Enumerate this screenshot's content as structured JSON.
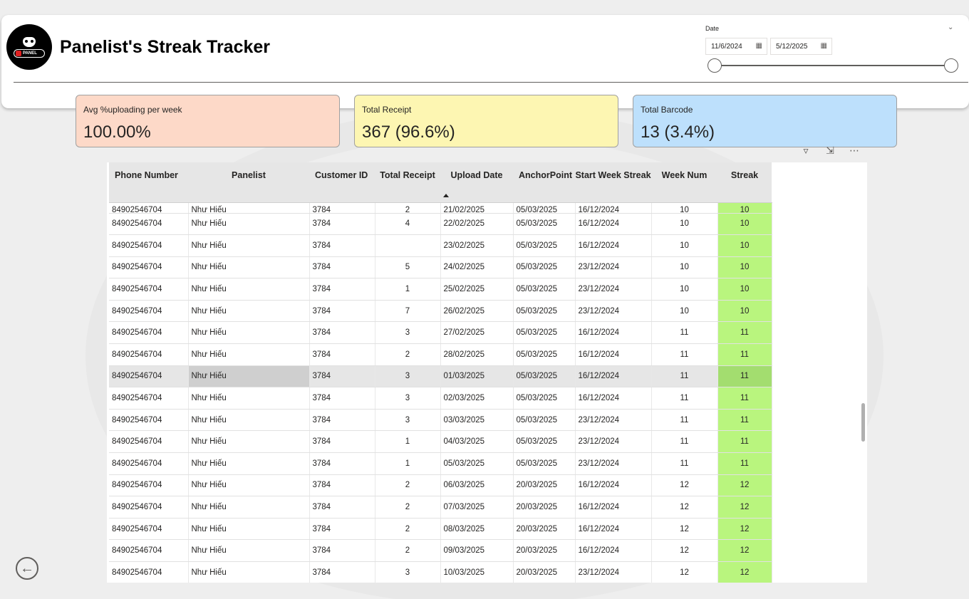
{
  "header": {
    "title": "Panelist's Streak Tracker",
    "logo_text": "PANEL"
  },
  "date_slicer": {
    "label": "Date",
    "start": "11/6/2024",
    "end": "5/12/2025"
  },
  "kpis": [
    {
      "label": "Avg %uploading per week",
      "value": "100.00%",
      "color": "#fdd9c8"
    },
    {
      "label": "Total Receipt",
      "value": "367 (96.6%)",
      "color": "#fdf6b2"
    },
    {
      "label": "Total Barcode",
      "value": "13 (3.4%)",
      "color": "#bde0fc"
    }
  ],
  "table": {
    "columns": [
      "Phone Number",
      "Panelist",
      "Customer ID",
      "Total Receipt",
      "Upload Date",
      "AnchorPoint",
      "Start Week Streak",
      "Week Num",
      "Streak"
    ],
    "rows": [
      [
        "84902546704",
        "Như Hiếu",
        "3784",
        "2",
        "21/02/2025",
        "05/03/2025",
        "16/12/2024",
        "10",
        "10"
      ],
      [
        "84902546704",
        "Như Hiếu",
        "3784",
        "4",
        "22/02/2025",
        "05/03/2025",
        "16/12/2024",
        "10",
        "10"
      ],
      [
        "84902546704",
        "Như Hiếu",
        "3784",
        "",
        "23/02/2025",
        "05/03/2025",
        "16/12/2024",
        "10",
        "10"
      ],
      [
        "84902546704",
        "Như Hiếu",
        "3784",
        "5",
        "24/02/2025",
        "05/03/2025",
        "23/12/2024",
        "10",
        "10"
      ],
      [
        "84902546704",
        "Như Hiếu",
        "3784",
        "1",
        "25/02/2025",
        "05/03/2025",
        "23/12/2024",
        "10",
        "10"
      ],
      [
        "84902546704",
        "Như Hiếu",
        "3784",
        "7",
        "26/02/2025",
        "05/03/2025",
        "23/12/2024",
        "10",
        "10"
      ],
      [
        "84902546704",
        "Như Hiếu",
        "3784",
        "3",
        "27/02/2025",
        "05/03/2025",
        "16/12/2024",
        "11",
        "11"
      ],
      [
        "84902546704",
        "Như Hiếu",
        "3784",
        "2",
        "28/02/2025",
        "05/03/2025",
        "16/12/2024",
        "11",
        "11"
      ],
      [
        "84902546704",
        "Như Hiếu",
        "3784",
        "3",
        "01/03/2025",
        "05/03/2025",
        "16/12/2024",
        "11",
        "11"
      ],
      [
        "84902546704",
        "Như Hiếu",
        "3784",
        "3",
        "02/03/2025",
        "05/03/2025",
        "16/12/2024",
        "11",
        "11"
      ],
      [
        "84902546704",
        "Như Hiếu",
        "3784",
        "3",
        "03/03/2025",
        "05/03/2025",
        "23/12/2024",
        "11",
        "11"
      ],
      [
        "84902546704",
        "Như Hiếu",
        "3784",
        "1",
        "04/03/2025",
        "05/03/2025",
        "23/12/2024",
        "11",
        "11"
      ],
      [
        "84902546704",
        "Như Hiếu",
        "3784",
        "1",
        "05/03/2025",
        "05/03/2025",
        "23/12/2024",
        "11",
        "11"
      ],
      [
        "84902546704",
        "Như Hiếu",
        "3784",
        "2",
        "06/03/2025",
        "20/03/2025",
        "16/12/2024",
        "12",
        "12"
      ],
      [
        "84902546704",
        "Như Hiếu",
        "3784",
        "2",
        "07/03/2025",
        "20/03/2025",
        "16/12/2024",
        "12",
        "12"
      ],
      [
        "84902546704",
        "Như Hiếu",
        "3784",
        "2",
        "08/03/2025",
        "20/03/2025",
        "16/12/2024",
        "12",
        "12"
      ],
      [
        "84902546704",
        "Như Hiếu",
        "3784",
        "2",
        "09/03/2025",
        "20/03/2025",
        "16/12/2024",
        "12",
        "12"
      ],
      [
        "84902546704",
        "Như Hiếu",
        "3784",
        "3",
        "10/03/2025",
        "20/03/2025",
        "23/12/2024",
        "12",
        "12"
      ]
    ],
    "highlighted_row": 8,
    "streak_color": "#b9f57e"
  },
  "icons": {
    "filter": "filter-icon",
    "focus": "focus-mode-icon",
    "more": "more-options-icon",
    "back": "back-arrow-icon",
    "calendar": "calendar-icon"
  }
}
